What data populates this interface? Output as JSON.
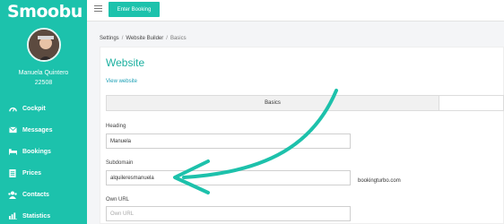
{
  "app": {
    "logo": "Smoobu"
  },
  "user": {
    "name": "Manuela Quintero",
    "id": "22508"
  },
  "sidebar": {
    "items": [
      {
        "label": "Cockpit",
        "icon": "dashboard-icon"
      },
      {
        "label": "Messages",
        "icon": "envelope-icon"
      },
      {
        "label": "Bookings",
        "icon": "bed-icon"
      },
      {
        "label": "Prices",
        "icon": "list-icon"
      },
      {
        "label": "Contacts",
        "icon": "contacts-icon"
      },
      {
        "label": "Statistics",
        "icon": "bar-chart-icon"
      }
    ]
  },
  "topbar": {
    "enter_booking_label": "Enter Booking"
  },
  "breadcrumb": {
    "items": [
      "Settings",
      "Website Builder",
      "Basics"
    ]
  },
  "main": {
    "title": "Website",
    "view_link": "View website",
    "tabs": [
      {
        "label": "Basics"
      },
      {
        "label": ""
      }
    ],
    "fields": {
      "heading": {
        "label": "Heading",
        "value": "Manuela"
      },
      "subdomain": {
        "label": "Subdomain",
        "value": "alquileresmanuela",
        "suffix": "bookingturbo.com"
      },
      "own_url": {
        "label": "Own URL",
        "placeholder": "Own URL"
      }
    }
  },
  "colors": {
    "accent": "#1cc2ac",
    "title": "#1cb0a0",
    "link": "#1a9fb5",
    "arrow": "#1dc1ab"
  }
}
